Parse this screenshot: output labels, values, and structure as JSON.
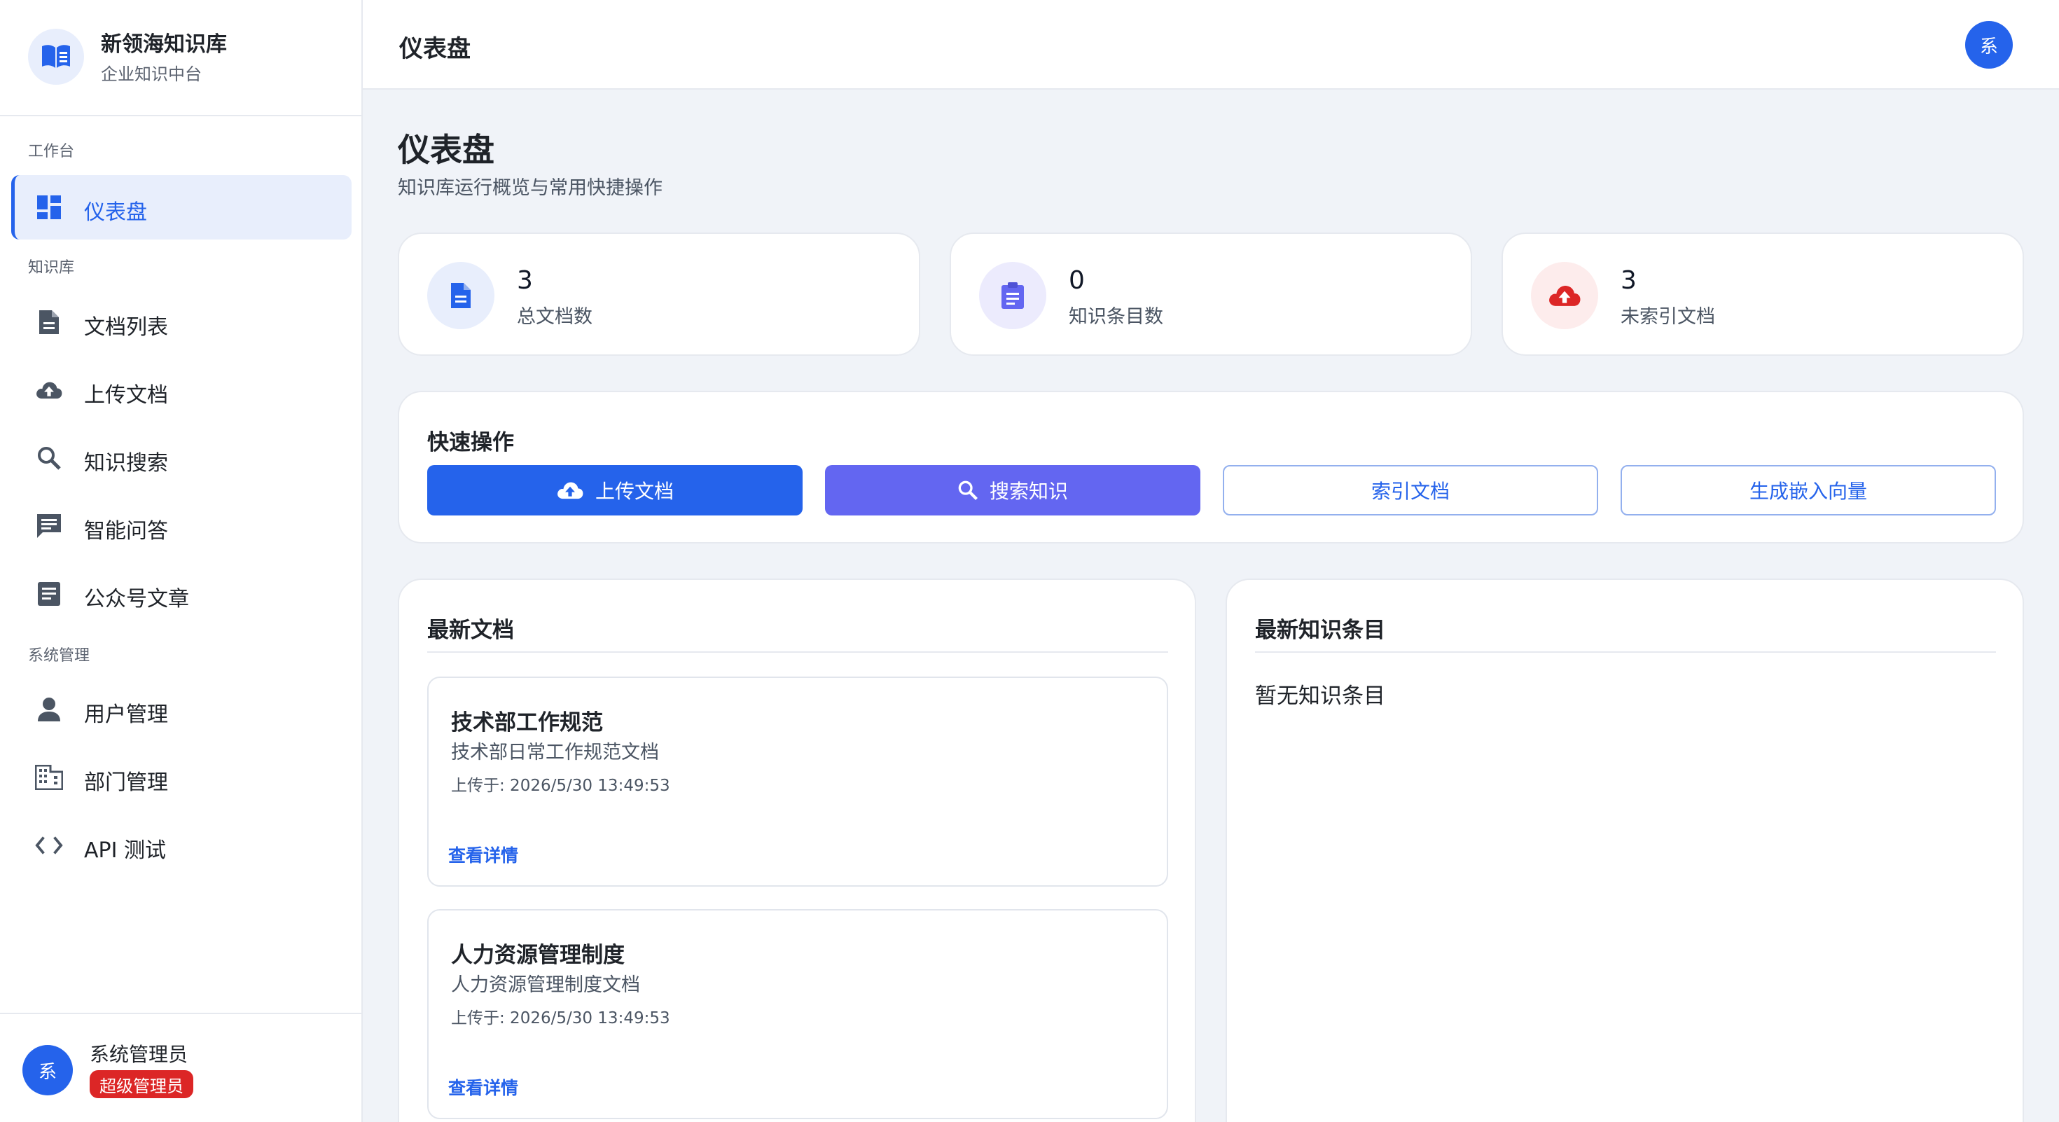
{
  "colors": {
    "primary": "#2563eb",
    "purple": "#6366f1",
    "danger": "#dc2626",
    "background": "#f0f3f8"
  },
  "brand": {
    "title": "新领海知识库",
    "subtitle": "企业知识中台",
    "icon": "book-open-icon"
  },
  "sidebar": {
    "sections": {
      "workbench": "工作台",
      "knowledge": "知识库",
      "system": "系统管理"
    },
    "items": [
      {
        "label": "仪表盘",
        "icon": "dashboard-icon",
        "active": true
      },
      {
        "label": "文档列表",
        "icon": "document-icon"
      },
      {
        "label": "上传文档",
        "icon": "cloud-upload-icon"
      },
      {
        "label": "知识搜索",
        "icon": "search-icon"
      },
      {
        "label": "智能问答",
        "icon": "chat-icon"
      },
      {
        "label": "公众号文章",
        "icon": "article-icon"
      },
      {
        "label": "用户管理",
        "icon": "user-icon"
      },
      {
        "label": "部门管理",
        "icon": "building-icon"
      },
      {
        "label": "API 测试",
        "icon": "code-icon"
      }
    ]
  },
  "user": {
    "avatar_text": "系",
    "name": "系统管理员",
    "role": "超级管理员"
  },
  "header": {
    "title": "仪表盘",
    "avatar_text": "系"
  },
  "page": {
    "title": "仪表盘",
    "subtitle": "知识库运行概览与常用快捷操作"
  },
  "stats": [
    {
      "value": "3",
      "label": "总文档数",
      "icon": "document-icon"
    },
    {
      "value": "0",
      "label": "知识条目数",
      "icon": "clipboard-icon"
    },
    {
      "value": "3",
      "label": "未索引文档",
      "icon": "cloud-upload-icon"
    }
  ],
  "quick_actions": {
    "title": "快速操作",
    "buttons": [
      {
        "label": "上传文档",
        "icon": "cloud-upload-icon"
      },
      {
        "label": "搜索知识",
        "icon": "search-icon"
      },
      {
        "label": "索引文档"
      },
      {
        "label": "生成嵌入向量"
      }
    ]
  },
  "latest_docs": {
    "title": "最新文档",
    "items": [
      {
        "title": "技术部工作规范",
        "description": "技术部日常工作规范文档",
        "uploaded": "上传于: 2026/5/30 13:49:53",
        "link": "查看详情"
      },
      {
        "title": "人力资源管理制度",
        "description": "人力资源管理制度文档",
        "uploaded": "上传于: 2026/5/30 13:49:53",
        "link": "查看详情"
      }
    ]
  },
  "latest_knowledge": {
    "title": "最新知识条目",
    "empty": "暂无知识条目"
  }
}
